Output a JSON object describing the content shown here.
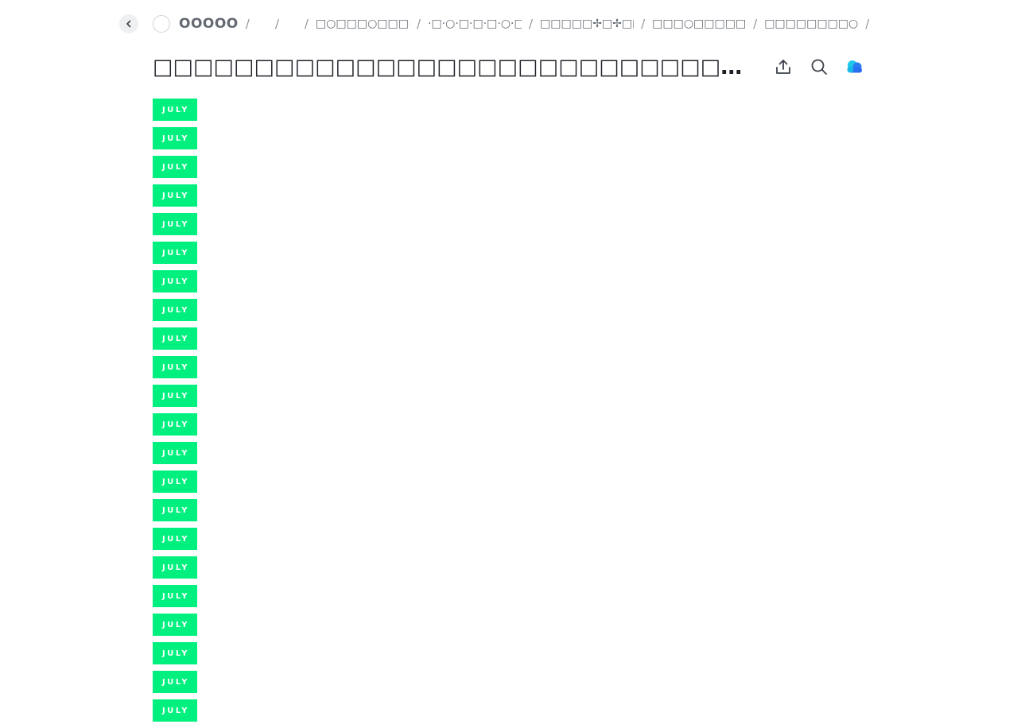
{
  "topbar": {
    "workspace_name": "OOOOO",
    "separator": "/",
    "breadcrumbs": [
      "",
      "",
      "□○□□□○□□□○",
      "·□·○·□·□·□·○·□",
      "□□□□□✢□✢□□",
      "□□□○□□□□□□□□",
      "□□□□□□□□○□□□",
      "□□□□□□□□□□□□□□□□□□"
    ]
  },
  "title": {
    "text": "□□□□□□□□□□□□□□□□□□□□□□□□□□□□□□□□□□□□□□□○□□□□□□□□□□□□□□□□□□□□□□"
  },
  "badges": {
    "label": "JULY",
    "items": [
      "JULY",
      "JULY",
      "JULY",
      "JULY",
      "JULY",
      "JULY",
      "JULY",
      "JULY",
      "JULY",
      "JULY",
      "JULY",
      "JULY",
      "JULY",
      "JULY",
      "JULY",
      "JULY",
      "JULY",
      "JULY",
      "JULY",
      "JULY",
      "JULY",
      "JULY"
    ]
  },
  "colors": {
    "badge": "#00f07f",
    "text": "#1f2329",
    "muted": "#646a73"
  },
  "icons": [
    "chevron-left-icon",
    "share-icon",
    "search-icon",
    "cloud-icon"
  ]
}
